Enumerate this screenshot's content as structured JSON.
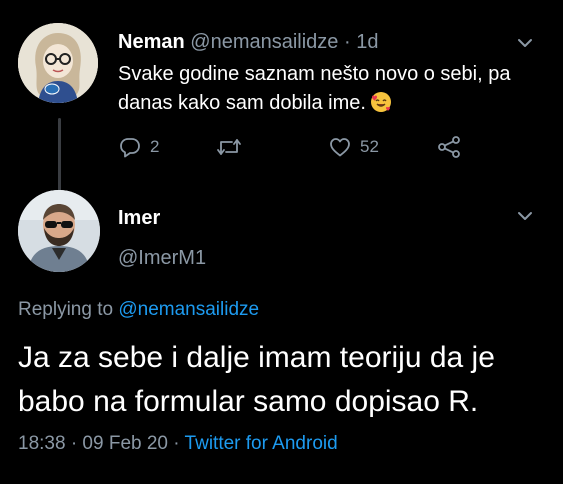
{
  "parent_tweet": {
    "display_name": "Neman",
    "handle": "@nemansailidze",
    "separator": "·",
    "time": "1d",
    "text": "Svake godine saznam nešto novo o sebi, pa danas kako sam dobila ime.",
    "emoji": "smiling-face-with-hearts",
    "replies_count": "2",
    "retweets_count": "",
    "likes_count": "52",
    "avatar": "cartoon-woman-with-glasses"
  },
  "reply_tweet": {
    "display_name": "Imer",
    "handle": "@ImerM1",
    "replying_to_label": "Replying to",
    "replying_to_handle": "@nemansailidze",
    "text": "Ja za sebe i dalje imam teoriju da je babo na formular samo dopisao R.",
    "timestamp": "18:38 · 09 Feb 20",
    "meta_separator": "·",
    "source": "Twitter for Android",
    "avatar": "man-with-sunglasses-and-beard"
  },
  "colors": {
    "background": "#000000",
    "primary_text": "#ffffff",
    "secondary_text": "#8b98a5",
    "link": "#1d9bf0",
    "thread_line": "#3a3d42"
  },
  "icons": [
    "chevron-down-icon",
    "reply-icon",
    "retweet-icon",
    "like-icon",
    "share-icon",
    "emoji-icon"
  ]
}
